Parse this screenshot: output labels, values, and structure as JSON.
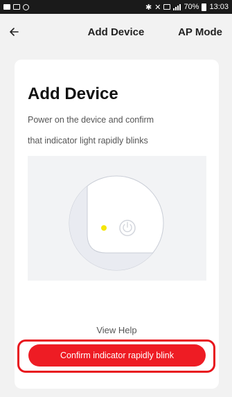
{
  "status_bar": {
    "left_icons": [
      "image-icon",
      "gallery-icon",
      "sync-icon"
    ],
    "right_icons": [
      "bluetooth-icon",
      "mute-icon",
      "nfc-icon",
      "signal-icon",
      "battery-icon"
    ],
    "battery": "70%",
    "time": "13:03"
  },
  "nav": {
    "back_icon": "arrow-left-icon",
    "title": "Add Device",
    "action": "AP Mode"
  },
  "card": {
    "heading": "Add Device",
    "description_line1": "Power on the device and confirm",
    "description_line2": "that indicator light rapidly blinks",
    "illustration_icons": [
      "device-outline-icon",
      "indicator-light-icon",
      "power-icon"
    ],
    "view_help": "View Help",
    "confirm_button": "Confirm indicator rapidly blink"
  },
  "colors": {
    "accent": "#ee1c24",
    "indicator": "#f5e60a",
    "page_bg": "#f2f2f2",
    "card_bg": "#ffffff"
  }
}
